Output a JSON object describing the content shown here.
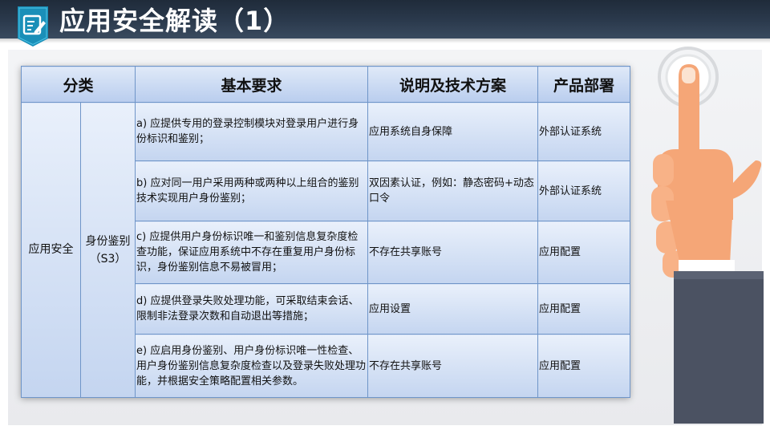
{
  "header": {
    "title": "应用安全解读（1）",
    "icon": "notepad-pen-icon"
  },
  "table": {
    "headers": {
      "category": "分类",
      "requirement": "基本要求",
      "explanation": "说明及技术方案",
      "deployment": "产品部署"
    },
    "category": "应用安全",
    "subcategory_line1": "身份鉴别",
    "subcategory_line2": "（S3）",
    "rows": [
      {
        "requirement": "a) 应提供专用的登录控制模块对登录用户进行身份标识和鉴别；",
        "explanation": "应用系统自身保障",
        "deployment": "外部认证系统"
      },
      {
        "requirement": "b) 应对同一用户采用两种或两种以上组合的鉴别技术实现用户身份鉴别；",
        "explanation": "双因素认证，例如：静态密码+动态口令",
        "deployment": "外部认证系统"
      },
      {
        "requirement": "c) 应提供用户身份标识唯一和鉴别信息复杂度检查功能，保证应用系统中不存在重复用户身份标识，身份鉴别信息不易被冒用；",
        "explanation": "不存在共享账号",
        "deployment": "应用配置"
      },
      {
        "requirement": "d) 应提供登录失败处理功能，可采取结束会话、限制非法登录次数和自动退出等措施；",
        "explanation": "应用设置",
        "deployment": "应用配置"
      },
      {
        "requirement": "e) 应启用身份鉴别、用户身份标识唯一性检查、用户身份鉴别信息复杂度检查以及登录失败处理功能，并根据安全策略配置相关参数。",
        "explanation": "不存在共享账号",
        "deployment": "应用配置"
      }
    ]
  },
  "decoration": {
    "hand": "pointing-hand-icon"
  },
  "colors": {
    "header_bg": "#2b3a4d",
    "badge": "#1a8fb8",
    "table_border": "#6f95c8",
    "cell_top": "#e9f0fb",
    "cell_bottom": "#c4d5f0"
  }
}
